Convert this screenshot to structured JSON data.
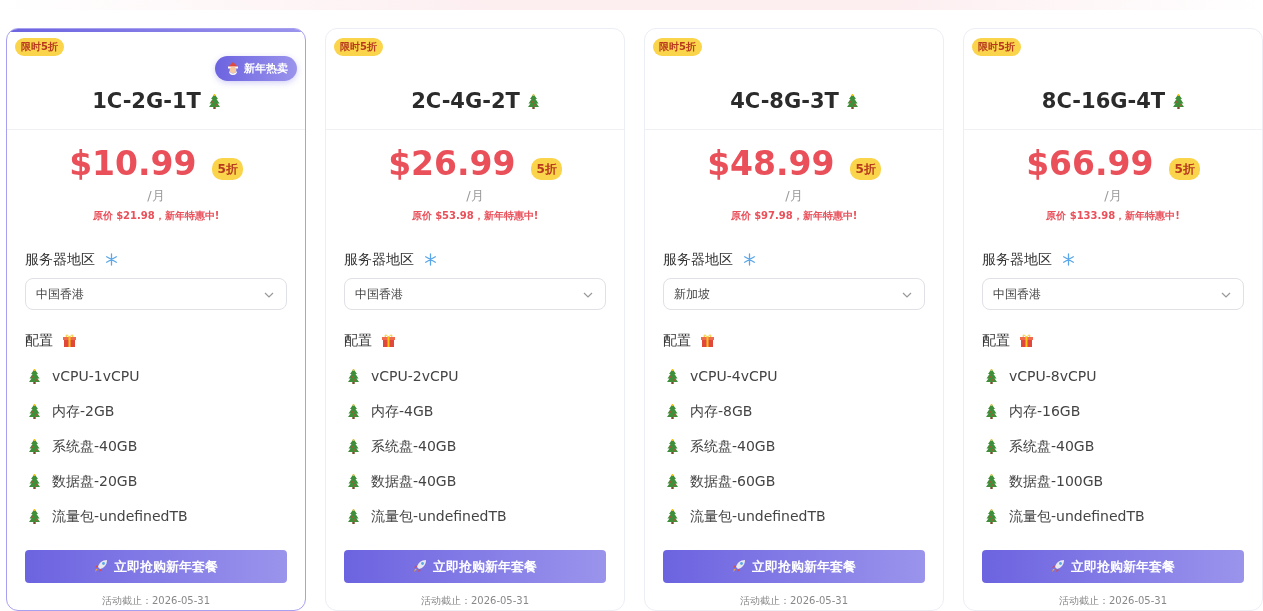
{
  "plans": [
    {
      "featured": true,
      "tag": "限时5折",
      "hot_badge": "新年热卖",
      "title": "1C-2G-1T",
      "price": "$10.99",
      "discount": "5折",
      "unit": "/月",
      "original": "原价 $21.98，新年特惠中!",
      "region_label": "服务器地区",
      "region": "中国香港",
      "config_label": "配置",
      "specs": [
        "vCPU-1vCPU",
        "内存-2GB",
        "系统盘-40GB",
        "数据盘-20GB",
        "流量包-undefinedTB"
      ],
      "button": "立即抢购新年套餐",
      "deadline": "活动截止：2026-05-31"
    },
    {
      "featured": false,
      "tag": "限时5折",
      "title": "2C-4G-2T",
      "price": "$26.99",
      "discount": "5折",
      "unit": "/月",
      "original": "原价 $53.98，新年特惠中!",
      "region_label": "服务器地区",
      "region": "中国香港",
      "config_label": "配置",
      "specs": [
        "vCPU-2vCPU",
        "内存-4GB",
        "系统盘-40GB",
        "数据盘-40GB",
        "流量包-undefinedTB"
      ],
      "button": "立即抢购新年套餐",
      "deadline": "活动截止：2026-05-31"
    },
    {
      "featured": false,
      "tag": "限时5折",
      "title": "4C-8G-3T",
      "price": "$48.99",
      "discount": "5折",
      "unit": "/月",
      "original": "原价 $97.98，新年特惠中!",
      "region_label": "服务器地区",
      "region": "新加坡",
      "config_label": "配置",
      "specs": [
        "vCPU-4vCPU",
        "内存-8GB",
        "系统盘-40GB",
        "数据盘-60GB",
        "流量包-undefinedTB"
      ],
      "button": "立即抢购新年套餐",
      "deadline": "活动截止：2026-05-31"
    },
    {
      "featured": false,
      "tag": "限时5折",
      "title": "8C-16G-4T",
      "price": "$66.99",
      "discount": "5折",
      "unit": "/月",
      "original": "原价 $133.98，新年特惠中!",
      "region_label": "服务器地区",
      "region": "中国香港",
      "config_label": "配置",
      "specs": [
        "vCPU-8vCPU",
        "内存-16GB",
        "系统盘-40GB",
        "数据盘-100GB",
        "流量包-undefinedTB"
      ],
      "button": "立即抢购新年套餐",
      "deadline": "活动截止：2026-05-31"
    }
  ]
}
